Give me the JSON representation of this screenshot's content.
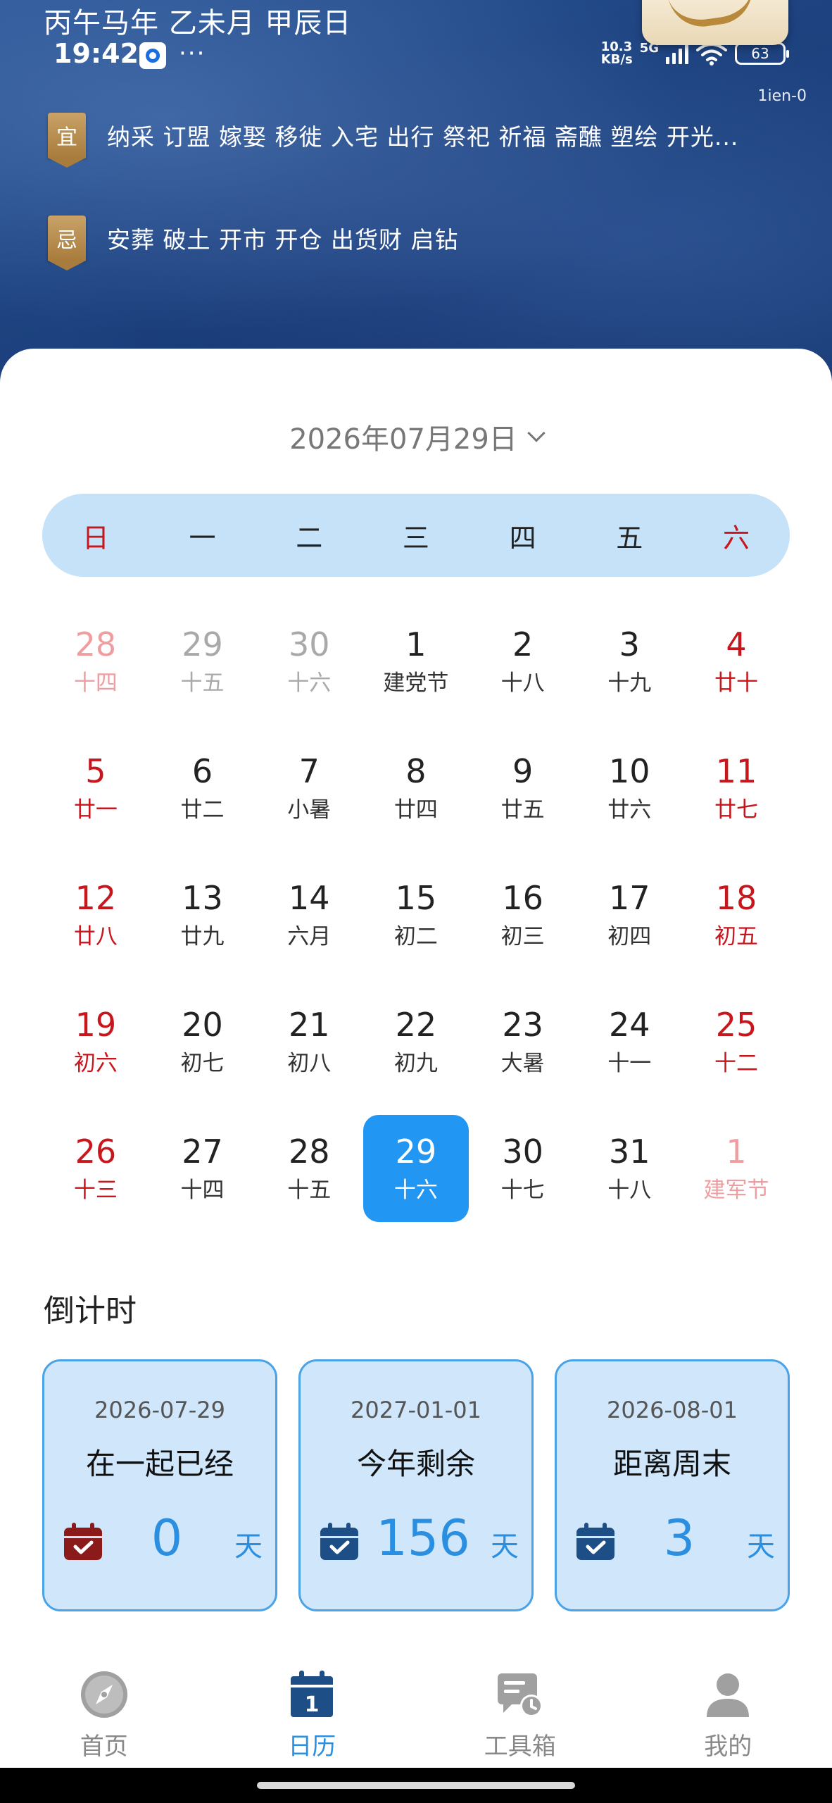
{
  "header": {
    "ganzhi": "丙午马年 乙未月 甲辰日",
    "corner_tag": "1ien-0",
    "yi": {
      "badge": "宜",
      "text": "纳采 订盟 嫁娶 移徙 入宅 出行 祭祀 祈福 斋醮 塑绘 开光..."
    },
    "ji": {
      "badge": "忌",
      "text": "安葬 破土 开市 开仓 出货财 启钻"
    }
  },
  "status_bar": {
    "time": "19:42",
    "dots": "···",
    "net_speed_value": "10.3",
    "net_speed_unit": "KB/s",
    "network": "5G",
    "battery": "63"
  },
  "calendar": {
    "date_selector": "2026年07月29日",
    "weekdays": [
      "日",
      "一",
      "二",
      "三",
      "四",
      "五",
      "六"
    ],
    "days": [
      {
        "num": "28",
        "lunar": "十四",
        "other": true
      },
      {
        "num": "29",
        "lunar": "十五",
        "other": true
      },
      {
        "num": "30",
        "lunar": "十六",
        "other": true
      },
      {
        "num": "1",
        "lunar": "建党节"
      },
      {
        "num": "2",
        "lunar": "十八"
      },
      {
        "num": "3",
        "lunar": "十九"
      },
      {
        "num": "4",
        "lunar": "廿十"
      },
      {
        "num": "5",
        "lunar": "廿一"
      },
      {
        "num": "6",
        "lunar": "廿二"
      },
      {
        "num": "7",
        "lunar": "小暑"
      },
      {
        "num": "8",
        "lunar": "廿四"
      },
      {
        "num": "9",
        "lunar": "廿五"
      },
      {
        "num": "10",
        "lunar": "廿六"
      },
      {
        "num": "11",
        "lunar": "廿七"
      },
      {
        "num": "12",
        "lunar": "廿八"
      },
      {
        "num": "13",
        "lunar": "廿九"
      },
      {
        "num": "14",
        "lunar": "六月"
      },
      {
        "num": "15",
        "lunar": "初二"
      },
      {
        "num": "16",
        "lunar": "初三"
      },
      {
        "num": "17",
        "lunar": "初四"
      },
      {
        "num": "18",
        "lunar": "初五"
      },
      {
        "num": "19",
        "lunar": "初六"
      },
      {
        "num": "20",
        "lunar": "初七"
      },
      {
        "num": "21",
        "lunar": "初八"
      },
      {
        "num": "22",
        "lunar": "初九"
      },
      {
        "num": "23",
        "lunar": "大暑"
      },
      {
        "num": "24",
        "lunar": "十一"
      },
      {
        "num": "25",
        "lunar": "十二"
      },
      {
        "num": "26",
        "lunar": "十三"
      },
      {
        "num": "27",
        "lunar": "十四"
      },
      {
        "num": "28",
        "lunar": "十五"
      },
      {
        "num": "29",
        "lunar": "十六",
        "selected": true
      },
      {
        "num": "30",
        "lunar": "十七"
      },
      {
        "num": "31",
        "lunar": "十八"
      },
      {
        "num": "1",
        "lunar": "建军节",
        "other": true
      }
    ]
  },
  "countdown": {
    "title": "倒计时",
    "cards": [
      {
        "date": "2026-07-29",
        "label": "在一起已经",
        "value": "0",
        "unit": "天",
        "icon_color": "#8b1a1a"
      },
      {
        "date": "2027-01-01",
        "label": "今年剩余",
        "value": "156",
        "unit": "天",
        "icon_color": "#1e4e86"
      },
      {
        "date": "2026-08-01",
        "label": "距离周末",
        "value": "3",
        "unit": "天",
        "icon_color": "#1e4e86"
      }
    ]
  },
  "bottom_nav": [
    {
      "label": "首页",
      "icon": "compass-icon",
      "active": false
    },
    {
      "label": "日历",
      "icon": "calendar-icon",
      "active": true
    },
    {
      "label": "工具箱",
      "icon": "toolbox-icon",
      "active": false
    },
    {
      "label": "我的",
      "icon": "person-icon",
      "active": false
    }
  ],
  "colors": {
    "accent": "#2196f3",
    "weekend_red": "#c8161d",
    "weekday_bar": "#c5e2f9",
    "header_blue": "#1d427f"
  }
}
